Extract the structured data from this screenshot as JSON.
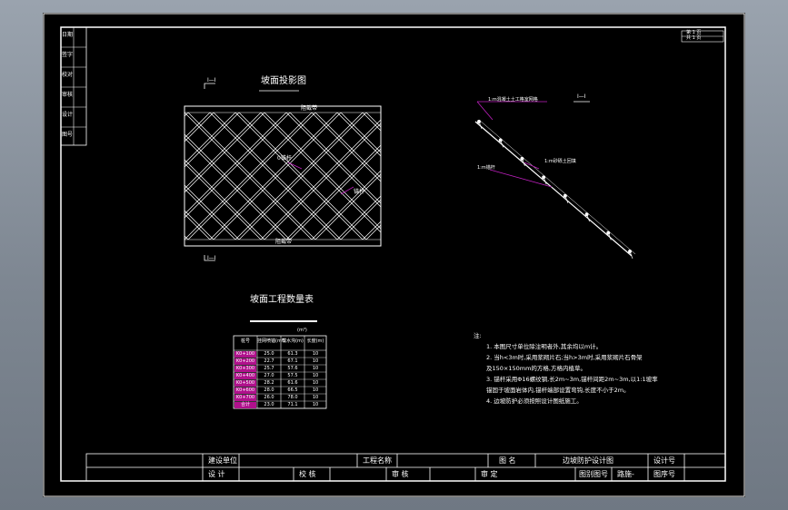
{
  "drawing": {
    "elevation_title": "坡面投影图",
    "elevation_section_mark": "I—I",
    "top_label": "阻截带",
    "bottom_label": "阻截带",
    "inner_label_left": "0锚杆",
    "inner_label_right": "锚杆",
    "section_title": "I—I",
    "section_label_1": "1:m混凝土土工格室网格",
    "section_label_2": "1:m砂砾土回填",
    "section_label_3": "1:m锚杆",
    "qty_table_title": "坡面工程数量表",
    "qty_table_unit": "(m³)",
    "qty_table_headers": [
      "桩号",
      "挂网喷锚(m²)",
      "截水沟(m)",
      "长度(m)"
    ],
    "qty_table_rows": [
      [
        "K0+100",
        "25.0",
        "61.3",
        "10"
      ],
      [
        "K0+200",
        "22.7",
        "67.1",
        "10"
      ],
      [
        "K0+300",
        "25.7",
        "57.6",
        "10"
      ],
      [
        "K0+400",
        "27.0",
        "57.5",
        "10"
      ],
      [
        "K0+500",
        "28.2",
        "61.6",
        "10"
      ],
      [
        "K0+600",
        "28.0",
        "66.5",
        "10"
      ],
      [
        "K0+700",
        "26.0",
        "78.0",
        "10"
      ],
      [
        "合计",
        "23.0",
        "71.1",
        "10"
      ]
    ],
    "notes_title": "注:",
    "notes": [
      "1. 本图尺寸单位除注明者外,其余均以m计。",
      "2. 当h<3m时,采用浆砌片石;当h>3m时,采用浆砌片石骨架",
      "   及150×150mm的方格,方格内植草。",
      "3. 锚杆采用Φ16螺纹钢,长2m~3m,锚杆间距2m~3m,以1:1坡率",
      "   锚固于坡面岩体内,锚杆端部设置弯钩,长度不小于2m。",
      "4. 边坡防护必须按照设计图纸施工。"
    ],
    "left_strip_labels": [
      "日期",
      "签字",
      "校对",
      "审核",
      "设计",
      "图号"
    ],
    "top_right": [
      "第 1 页",
      "共 1 页"
    ]
  },
  "title_block": {
    "row1": [
      "建设单位",
      "",
      "工程名称",
      "",
      "图 名",
      "边坡防护设计图",
      "设计号"
    ],
    "row2": [
      "设 计",
      "",
      "校 核",
      "",
      "审 核",
      "",
      "审 定",
      "",
      "图别图号",
      "路施-",
      "图序号"
    ]
  },
  "colors": {
    "fill": "#b0108c",
    "accent": "#c020c0",
    "line": "#ffffff"
  }
}
